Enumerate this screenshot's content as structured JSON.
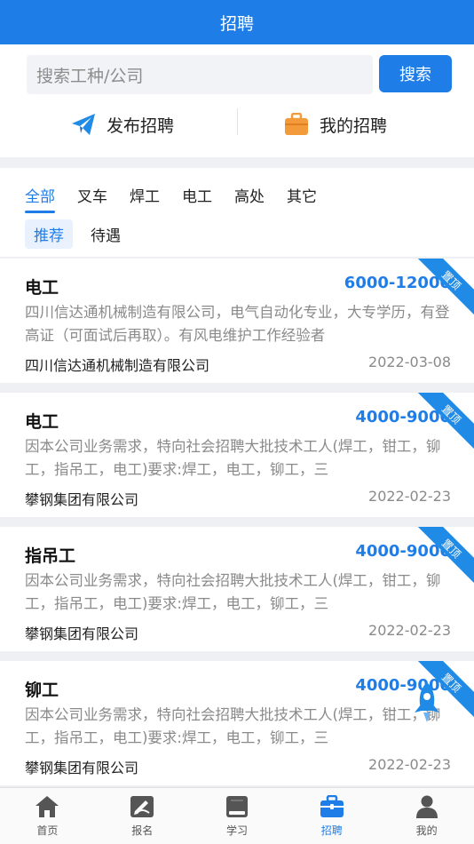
{
  "header": {
    "title": "招聘"
  },
  "search": {
    "placeholder": "搜索工种/公司",
    "button_label": "搜索"
  },
  "actions": {
    "publish_label": "发布招聘",
    "mine_label": "我的招聘"
  },
  "categories": [
    "全部",
    "叉车",
    "焊工",
    "电工",
    "高处",
    "其它"
  ],
  "active_category": "全部",
  "subtabs": [
    "推荐",
    "待遇"
  ],
  "active_subtab": "推荐",
  "jobs": [
    {
      "title": "电工",
      "salary": "6000-12000",
      "badge": "置顶",
      "description": "四川信达通机械制造有限公司，电气自动化专业，大专学历，有登高证（可面试后再取）。有风电维护工作经验者",
      "company": "四川信达通机械制造有限公司",
      "date": "2022-03-08"
    },
    {
      "title": "电工",
      "salary": "4000-9000",
      "badge": "置顶",
      "description": "因本公司业务需求，特向社会招聘大批技术工人(焊工，钳工，铆工，指吊工，电工)要求:焊工，电工，铆工，三",
      "company": "攀钢集团有限公司",
      "date": "2022-02-23"
    },
    {
      "title": "指吊工",
      "salary": "4000-9000",
      "badge": "置顶",
      "description": "因本公司业务需求，特向社会招聘大批技术工人(焊工，钳工，铆工，指吊工，电工)要求:焊工，电工，铆工，三",
      "company": "攀钢集团有限公司",
      "date": "2022-02-23"
    },
    {
      "title": "铆工",
      "salary": "4000-9000",
      "badge": "置顶",
      "description": "因本公司业务需求，特向社会招聘大批技术工人(焊工，钳工，铆工，指吊工，电工)要求:焊工，电工，铆工，三",
      "company": "攀钢集团有限公司",
      "date": "2022-02-23"
    }
  ],
  "tabbar": {
    "items": [
      {
        "label": "首页",
        "icon": "home-icon"
      },
      {
        "label": "报名",
        "icon": "signup-icon"
      },
      {
        "label": "学习",
        "icon": "book-icon"
      },
      {
        "label": "招聘",
        "icon": "briefcase-icon"
      },
      {
        "label": "我的",
        "icon": "user-icon"
      }
    ],
    "active": "招聘"
  },
  "colors": {
    "accent": "#1f7de8",
    "muted_text": "#8a8a8a",
    "publish_icon": "#1f8be6",
    "mine_icon": "#f39a3a"
  }
}
